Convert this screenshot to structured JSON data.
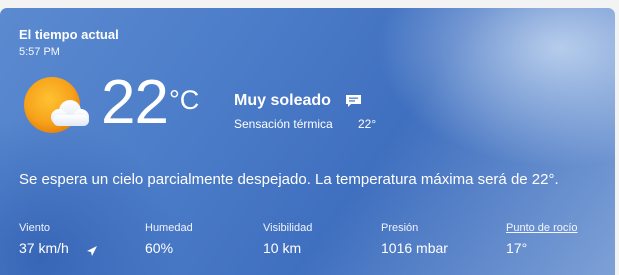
{
  "header": {
    "title": "El tiempo actual",
    "time": "5:57 PM"
  },
  "current": {
    "icon": "sun-behind-cloud-icon",
    "temperature": "22",
    "unit": "°C",
    "condition": "Muy soleado",
    "feels_like_label": "Sensación térmica",
    "feels_like_value": "22°"
  },
  "summary": "Se espera un cielo parcialmente despejado. La temperatura máxima será de 22°.",
  "details": [
    {
      "label": "Viento",
      "value": "37 km/h"
    },
    {
      "label": "Humedad",
      "value": "60%"
    },
    {
      "label": "Visibilidad",
      "value": "10 km"
    },
    {
      "label": "Presión",
      "value": "1016 mbar"
    },
    {
      "label": "Punto de rocío",
      "value": "17°"
    }
  ],
  "colors": {
    "card_gradient_start": "#5b8ad0",
    "card_gradient_end": "#7da0d6",
    "text": "#ffffff",
    "sun": "#f5a623"
  }
}
